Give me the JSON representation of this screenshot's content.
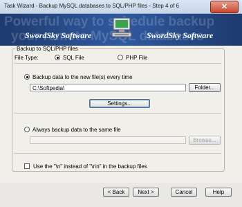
{
  "window": {
    "title": "Task Wizard - Backup MySQL databases to SQL/PHP files - Step 4 of 6",
    "close_glyph": "✕"
  },
  "banner": {
    "watermark_line1": "Powerful way to schedule backup",
    "watermark_line2": "your remote MySQL databases",
    "brand_left": "SwordSky Software",
    "brand_right": "SwordSky Software"
  },
  "backup_group": {
    "legend": "Backup to SQL/PHP files",
    "file_type_label": "File Type:",
    "sql_option": "SQL File",
    "php_option": "PHP File",
    "selected_type": "SQL File",
    "new_file_option": "Backup data to the new file(s) every time",
    "new_file_selected": true,
    "folder_path": "C:\\Softpedia\\",
    "folder_button": "Folder...",
    "settings_button": "Settings...",
    "same_file_option": "Always backup data to the same file",
    "same_file_path": "",
    "browse_button": "Browse...",
    "newline_checkbox": "Use the \"\\n\" instead of \"\\r\\n\" in the backup files",
    "newline_checked": false
  },
  "footer": {
    "back_button": "< Back",
    "next_button": "Next >",
    "cancel_button": "Cancel",
    "help_button": "Help"
  },
  "colors": {
    "banner": "#2f5aa0",
    "close_button": "#c9462c",
    "panel": "#f0efea"
  }
}
